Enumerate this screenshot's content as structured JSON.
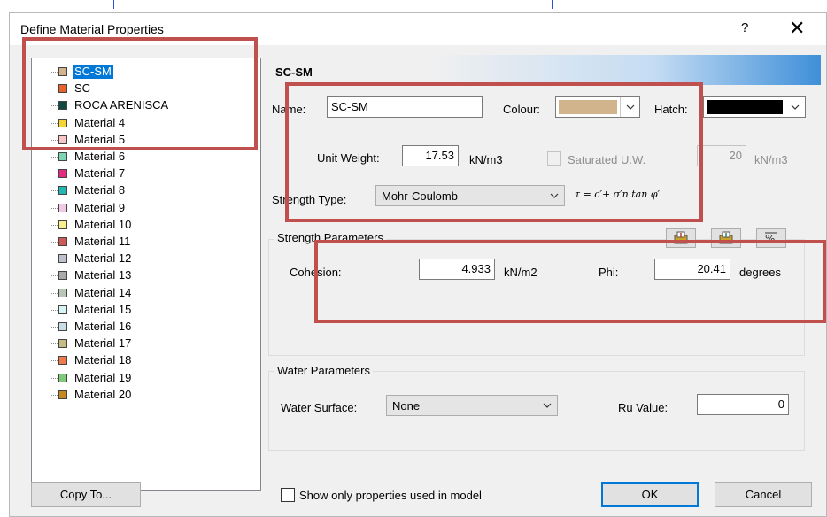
{
  "window": {
    "title": "Define Material Properties",
    "help_label": "?",
    "close_label": "✕"
  },
  "materials": [
    {
      "name": "SC-SM",
      "color": "#d2b48c"
    },
    {
      "name": "SC",
      "color": "#e8632b"
    },
    {
      "name": "ROCA ARENISCA",
      "color": "#0f4a42"
    },
    {
      "name": "Material 4",
      "color": "#f4d435"
    },
    {
      "name": "Material 5",
      "color": "#f8c6c6"
    },
    {
      "name": "Material 6",
      "color": "#7fd4b3"
    },
    {
      "name": "Material 7",
      "color": "#e42b7f"
    },
    {
      "name": "Material 8",
      "color": "#1eb7b4"
    },
    {
      "name": "Material 9",
      "color": "#f2c8e4"
    },
    {
      "name": "Material 10",
      "color": "#f7ee8e"
    },
    {
      "name": "Material 11",
      "color": "#cc5b57"
    },
    {
      "name": "Material 12",
      "color": "#bfc2cc"
    },
    {
      "name": "Material 13",
      "color": "#a9a9a9"
    },
    {
      "name": "Material 14",
      "color": "#b9c6b7"
    },
    {
      "name": "Material 15",
      "color": "#d8f5f5"
    },
    {
      "name": "Material 16",
      "color": "#c8dde6"
    },
    {
      "name": "Material 17",
      "color": "#c4bb86"
    },
    {
      "name": "Material 18",
      "color": "#ef7a4b"
    },
    {
      "name": "Material 19",
      "color": "#7fc97a"
    },
    {
      "name": "Material 20",
      "color": "#c58a1e"
    }
  ],
  "selected_material": "SC-SM",
  "form": {
    "header": "SC-SM",
    "name_label": "Name:",
    "name_value": "SC-SM",
    "colour_label": "Colour:",
    "colour_value": "#d2b48c",
    "hatch_label": "Hatch:",
    "hatch_value": "#000000",
    "unit_weight_label": "Unit Weight:",
    "unit_weight_value": "17.53",
    "unit_weight_unit": "kN/m3",
    "saturated_label": "Saturated U.W.",
    "saturated_value": "20",
    "saturated_unit": "kN/m3",
    "strength_type_label": "Strength Type:",
    "strength_type_value": "Mohr-Coulomb",
    "formula": "τ = c′+ σ′n tan φ′"
  },
  "strength": {
    "group_label": "Strength Parameters",
    "cohesion_label": "Cohesion:",
    "cohesion_value": "4.933",
    "cohesion_unit": "kN/m2",
    "phi_label": "Phi:",
    "phi_value": "20.41",
    "phi_unit": "degrees"
  },
  "water": {
    "group_label": "Water Parameters",
    "surface_label": "Water Surface:",
    "surface_value": "None",
    "ru_label": "Ru Value:",
    "ru_value": "0"
  },
  "footer": {
    "copy_to_label": "Copy To...",
    "show_only_label": "Show only properties used in model",
    "ok_label": "OK",
    "cancel_label": "Cancel"
  },
  "colors": {
    "highlight": "#c0504d",
    "selection": "#0078d7"
  }
}
